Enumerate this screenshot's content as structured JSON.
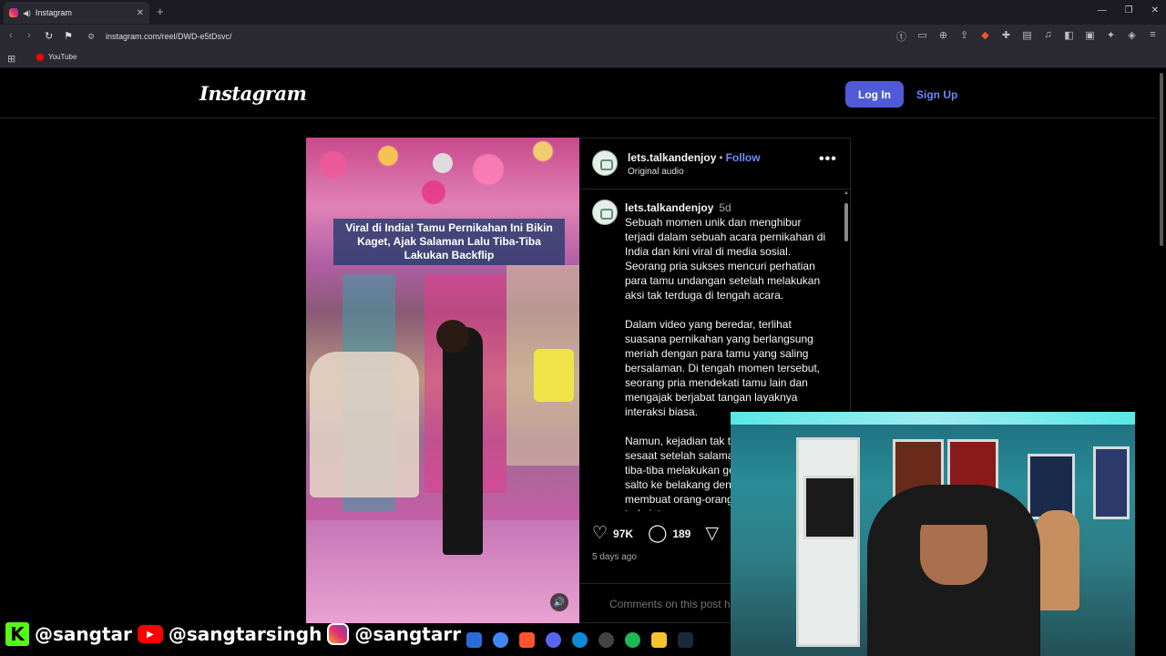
{
  "browser": {
    "tab_title": "Instagram",
    "new_tab": "+",
    "url": "instagram.com/reel/DWD-e5tDsvc/",
    "bookmark_youtube": "YouTube"
  },
  "header": {
    "logo": "Instagram",
    "login": "Log In",
    "signup": "Sign Up"
  },
  "video": {
    "caption": "Viral di India! Tamu Pernikahan Ini Bikin Kaget, Ajak Salaman Lalu Tiba-Tiba Lakukan Backflip"
  },
  "post": {
    "username": "lets.talkandenjoy",
    "follow": "Follow",
    "audio": "Original audio",
    "more": "•••",
    "caption_user": "lets.talkandenjoy",
    "caption_time": "5d",
    "paragraphs": [
      "Sebuah momen unik dan menghibur terjadi dalam sebuah acara pernikahan di India dan kini viral di media sosial. Seorang pria sukses mencuri perhatian para tamu undangan setelah melakukan aksi tak terduga di tengah acara.",
      "Dalam video yang beredar, terlihat suasana pernikahan yang berlangsung meriah dengan para tamu yang saling bersalaman. Di tengah momen tersebut, seorang pria mendekati tamu lain dan mengajak berjabat tangan layaknya interaksi biasa.",
      "Namun, kejadian tak terduga terjadi sesaat setelah salaman. Pria tersebut tiba-tiba melakukan gerakan backflip atau salto ke belakang dengan sangat lincah, membuat orang-orang di sekitarnya terkejut se"
    ],
    "likes": "97K",
    "comments": "189",
    "posted_ago": "5 days ago",
    "comments_off": "Comments on this post have been limited."
  },
  "social": {
    "kick": "@sangtar",
    "youtube": "@sangtarsingh",
    "instagram": "@sangtarr",
    "kick_letter": "K",
    "yt_glyph": "▶"
  },
  "colors": {
    "login_button": "#4f5bd5",
    "link": "#6e8cf5",
    "kick": "#53fc18",
    "youtube": "#ff0000"
  }
}
